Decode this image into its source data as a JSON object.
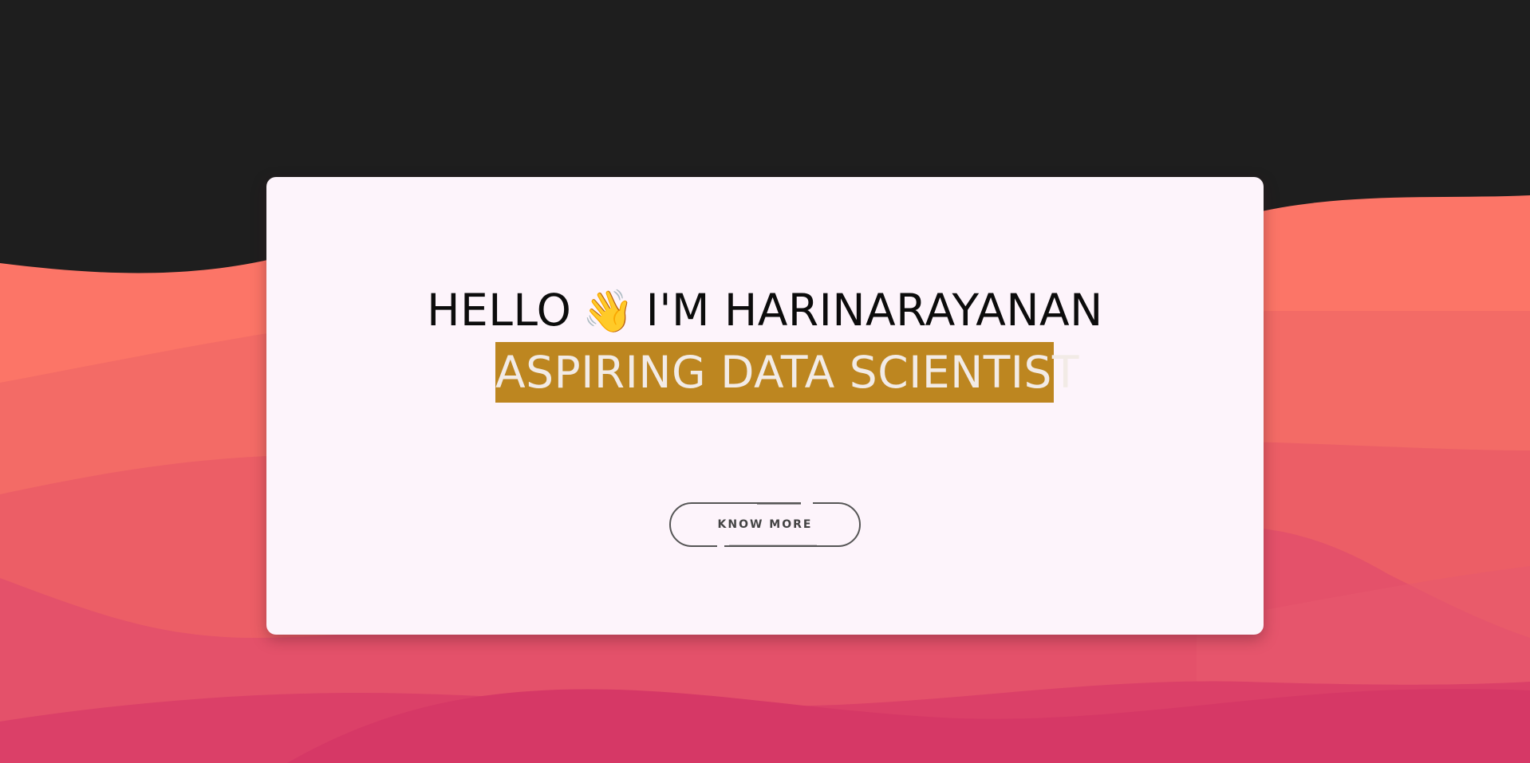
{
  "colors": {
    "background_dark": "#1e1e1e",
    "card_background": "#fdf4fb",
    "highlight_background": "#bd8620",
    "highlight_text": "#f2ebe6",
    "wave_layer_1": "#fc7567",
    "wave_layer_2": "#f36b66",
    "wave_layer_3": "#ec5e66",
    "wave_layer_4": "#e4516a",
    "wave_layer_5": "#db4068",
    "button_outline": "#555555"
  },
  "hero": {
    "greeting_prefix": "HELLO",
    "wave_icon": "👋",
    "greeting_suffix": "I'M HARINARAYANAN",
    "role": "ASPIRING DATA SCIENTIST"
  },
  "cta": {
    "label": "KNOW MORE"
  }
}
